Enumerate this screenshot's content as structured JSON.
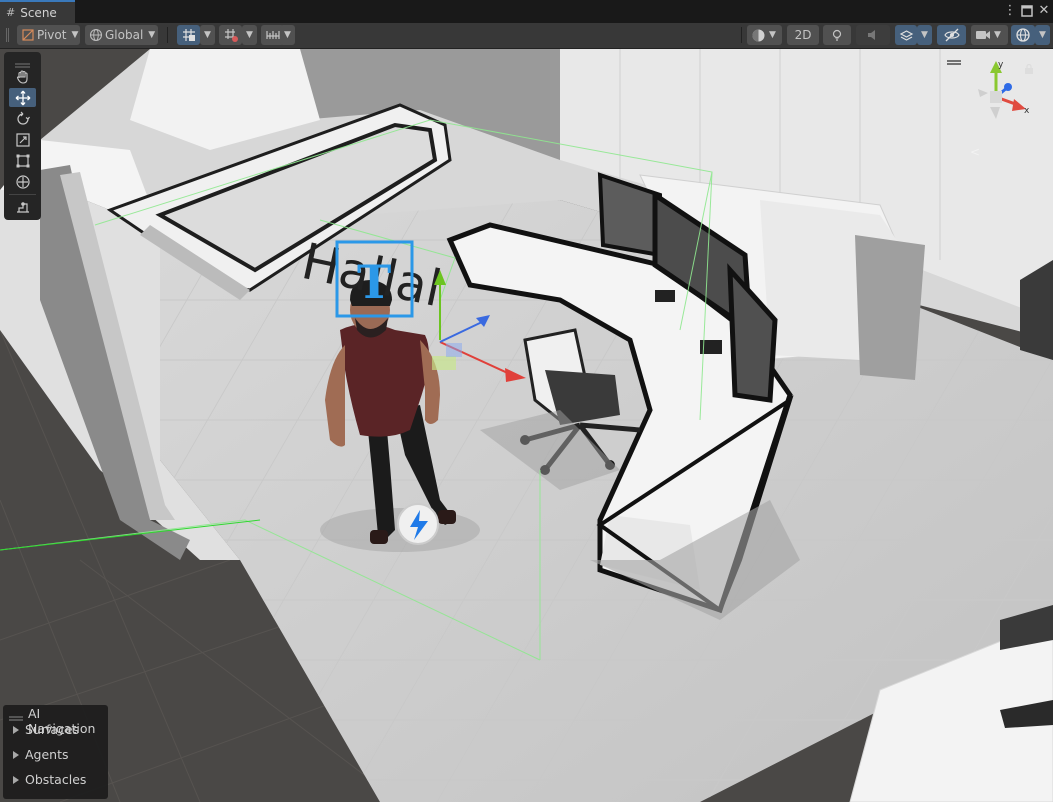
{
  "window": {
    "tab_label": "Scene"
  },
  "toolbar": {
    "pivot_label": "Pivot",
    "global_label": "Global",
    "two_d_label": "2D"
  },
  "scene": {
    "text_mesh": "Hallal"
  },
  "ai_navigation": {
    "title": "AI Navigation",
    "items": [
      {
        "label": "Surfaces"
      },
      {
        "label": "Agents"
      },
      {
        "label": "Obstacles"
      }
    ]
  },
  "gizmo": {
    "y_label": "y",
    "x_label": "x"
  },
  "colors": {
    "accent": "#3a79bb",
    "active_button": "#46607c",
    "toolbar_bg": "#383838",
    "bounds_green": "#7fe87f"
  }
}
